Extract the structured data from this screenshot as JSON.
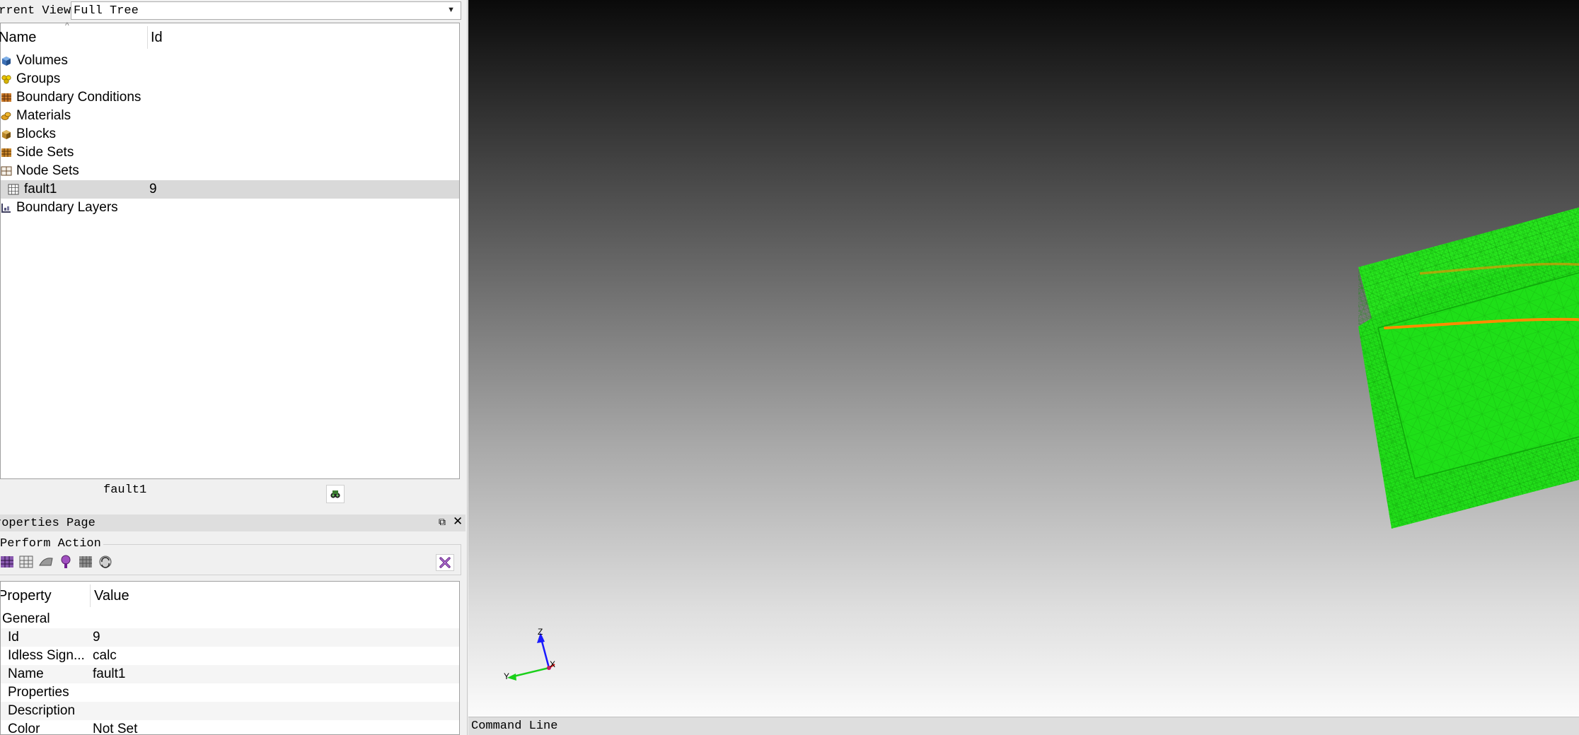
{
  "view_bar": {
    "label": "urrent View",
    "selected_view": "Full Tree"
  },
  "tree": {
    "columns": {
      "name": "Name",
      "id": "Id"
    },
    "items": [
      {
        "label": "Volumes",
        "id": "",
        "icon": "volume-icon"
      },
      {
        "label": "Groups",
        "id": "",
        "icon": "group-icon"
      },
      {
        "label": "Boundary Conditions",
        "id": "",
        "icon": "boundary-conditions-icon"
      },
      {
        "label": "Materials",
        "id": "",
        "icon": "materials-icon"
      },
      {
        "label": "Blocks",
        "id": "",
        "icon": "blocks-icon"
      },
      {
        "label": "Side Sets",
        "id": "",
        "icon": "side-sets-icon"
      },
      {
        "label": "Node Sets",
        "id": "",
        "icon": "node-sets-icon"
      },
      {
        "label": "fault1",
        "id": "9",
        "icon": "node-set-icon",
        "selected": true
      },
      {
        "label": "Boundary Layers",
        "id": "",
        "icon": "boundary-layers-icon"
      }
    ],
    "status_text": "fault1"
  },
  "properties": {
    "title": "roperties Page",
    "perform_action_label": "Perform Action",
    "columns": {
      "property": "Property",
      "value": "Value"
    },
    "rows": [
      {
        "key": "General",
        "value": "",
        "group": true
      },
      {
        "key": "Id",
        "value": "9"
      },
      {
        "key": "Idless Sign...",
        "value": "calc"
      },
      {
        "key": "Name",
        "value": "fault1"
      },
      {
        "key": "Properties",
        "value": ""
      },
      {
        "key": "Description",
        "value": ""
      },
      {
        "key": "Color",
        "value": "Not Set"
      }
    ]
  },
  "viewport": {
    "mesh_color": "#22e01a",
    "fault_line_color": "#ff8c00",
    "axes": {
      "z": "Z",
      "x": "X",
      "y": "Y"
    }
  },
  "command_line": {
    "label": "Command Line"
  }
}
